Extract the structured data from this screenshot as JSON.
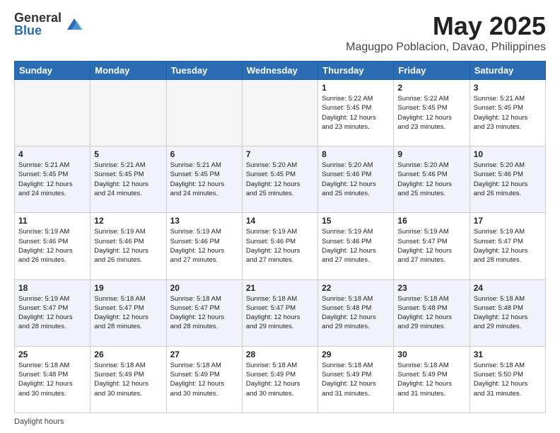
{
  "header": {
    "logo_general": "General",
    "logo_blue": "Blue",
    "main_title": "May 2025",
    "subtitle": "Magugpo Poblacion, Davao, Philippines"
  },
  "days_of_week": [
    "Sunday",
    "Monday",
    "Tuesday",
    "Wednesday",
    "Thursday",
    "Friday",
    "Saturday"
  ],
  "weeks": [
    [
      {
        "day": "",
        "info": "",
        "empty": true
      },
      {
        "day": "",
        "info": "",
        "empty": true
      },
      {
        "day": "",
        "info": "",
        "empty": true
      },
      {
        "day": "",
        "info": "",
        "empty": true
      },
      {
        "day": "1",
        "info": "Sunrise: 5:22 AM\nSunset: 5:45 PM\nDaylight: 12 hours\nand 23 minutes."
      },
      {
        "day": "2",
        "info": "Sunrise: 5:22 AM\nSunset: 5:45 PM\nDaylight: 12 hours\nand 23 minutes."
      },
      {
        "day": "3",
        "info": "Sunrise: 5:21 AM\nSunset: 5:45 PM\nDaylight: 12 hours\nand 23 minutes."
      }
    ],
    [
      {
        "day": "4",
        "info": "Sunrise: 5:21 AM\nSunset: 5:45 PM\nDaylight: 12 hours\nand 24 minutes."
      },
      {
        "day": "5",
        "info": "Sunrise: 5:21 AM\nSunset: 5:45 PM\nDaylight: 12 hours\nand 24 minutes."
      },
      {
        "day": "6",
        "info": "Sunrise: 5:21 AM\nSunset: 5:45 PM\nDaylight: 12 hours\nand 24 minutes."
      },
      {
        "day": "7",
        "info": "Sunrise: 5:20 AM\nSunset: 5:45 PM\nDaylight: 12 hours\nand 25 minutes."
      },
      {
        "day": "8",
        "info": "Sunrise: 5:20 AM\nSunset: 5:46 PM\nDaylight: 12 hours\nand 25 minutes."
      },
      {
        "day": "9",
        "info": "Sunrise: 5:20 AM\nSunset: 5:46 PM\nDaylight: 12 hours\nand 25 minutes."
      },
      {
        "day": "10",
        "info": "Sunrise: 5:20 AM\nSunset: 5:46 PM\nDaylight: 12 hours\nand 26 minutes."
      }
    ],
    [
      {
        "day": "11",
        "info": "Sunrise: 5:19 AM\nSunset: 5:46 PM\nDaylight: 12 hours\nand 26 minutes."
      },
      {
        "day": "12",
        "info": "Sunrise: 5:19 AM\nSunset: 5:46 PM\nDaylight: 12 hours\nand 26 minutes."
      },
      {
        "day": "13",
        "info": "Sunrise: 5:19 AM\nSunset: 5:46 PM\nDaylight: 12 hours\nand 27 minutes."
      },
      {
        "day": "14",
        "info": "Sunrise: 5:19 AM\nSunset: 5:46 PM\nDaylight: 12 hours\nand 27 minutes."
      },
      {
        "day": "15",
        "info": "Sunrise: 5:19 AM\nSunset: 5:46 PM\nDaylight: 12 hours\nand 27 minutes."
      },
      {
        "day": "16",
        "info": "Sunrise: 5:19 AM\nSunset: 5:47 PM\nDaylight: 12 hours\nand 27 minutes."
      },
      {
        "day": "17",
        "info": "Sunrise: 5:19 AM\nSunset: 5:47 PM\nDaylight: 12 hours\nand 28 minutes."
      }
    ],
    [
      {
        "day": "18",
        "info": "Sunrise: 5:19 AM\nSunset: 5:47 PM\nDaylight: 12 hours\nand 28 minutes."
      },
      {
        "day": "19",
        "info": "Sunrise: 5:18 AM\nSunset: 5:47 PM\nDaylight: 12 hours\nand 28 minutes."
      },
      {
        "day": "20",
        "info": "Sunrise: 5:18 AM\nSunset: 5:47 PM\nDaylight: 12 hours\nand 28 minutes."
      },
      {
        "day": "21",
        "info": "Sunrise: 5:18 AM\nSunset: 5:47 PM\nDaylight: 12 hours\nand 29 minutes."
      },
      {
        "day": "22",
        "info": "Sunrise: 5:18 AM\nSunset: 5:48 PM\nDaylight: 12 hours\nand 29 minutes."
      },
      {
        "day": "23",
        "info": "Sunrise: 5:18 AM\nSunset: 5:48 PM\nDaylight: 12 hours\nand 29 minutes."
      },
      {
        "day": "24",
        "info": "Sunrise: 5:18 AM\nSunset: 5:48 PM\nDaylight: 12 hours\nand 29 minutes."
      }
    ],
    [
      {
        "day": "25",
        "info": "Sunrise: 5:18 AM\nSunset: 5:48 PM\nDaylight: 12 hours\nand 30 minutes."
      },
      {
        "day": "26",
        "info": "Sunrise: 5:18 AM\nSunset: 5:49 PM\nDaylight: 12 hours\nand 30 minutes."
      },
      {
        "day": "27",
        "info": "Sunrise: 5:18 AM\nSunset: 5:49 PM\nDaylight: 12 hours\nand 30 minutes."
      },
      {
        "day": "28",
        "info": "Sunrise: 5:18 AM\nSunset: 5:49 PM\nDaylight: 12 hours\nand 30 minutes."
      },
      {
        "day": "29",
        "info": "Sunrise: 5:18 AM\nSunset: 5:49 PM\nDaylight: 12 hours\nand 31 minutes."
      },
      {
        "day": "30",
        "info": "Sunrise: 5:18 AM\nSunset: 5:49 PM\nDaylight: 12 hours\nand 31 minutes."
      },
      {
        "day": "31",
        "info": "Sunrise: 5:18 AM\nSunset: 5:50 PM\nDaylight: 12 hours\nand 31 minutes."
      }
    ]
  ],
  "footer": {
    "daylight_hours": "Daylight hours"
  },
  "colors": {
    "header_bg": "#2a6db5",
    "alt_row": "#eef2f8"
  }
}
